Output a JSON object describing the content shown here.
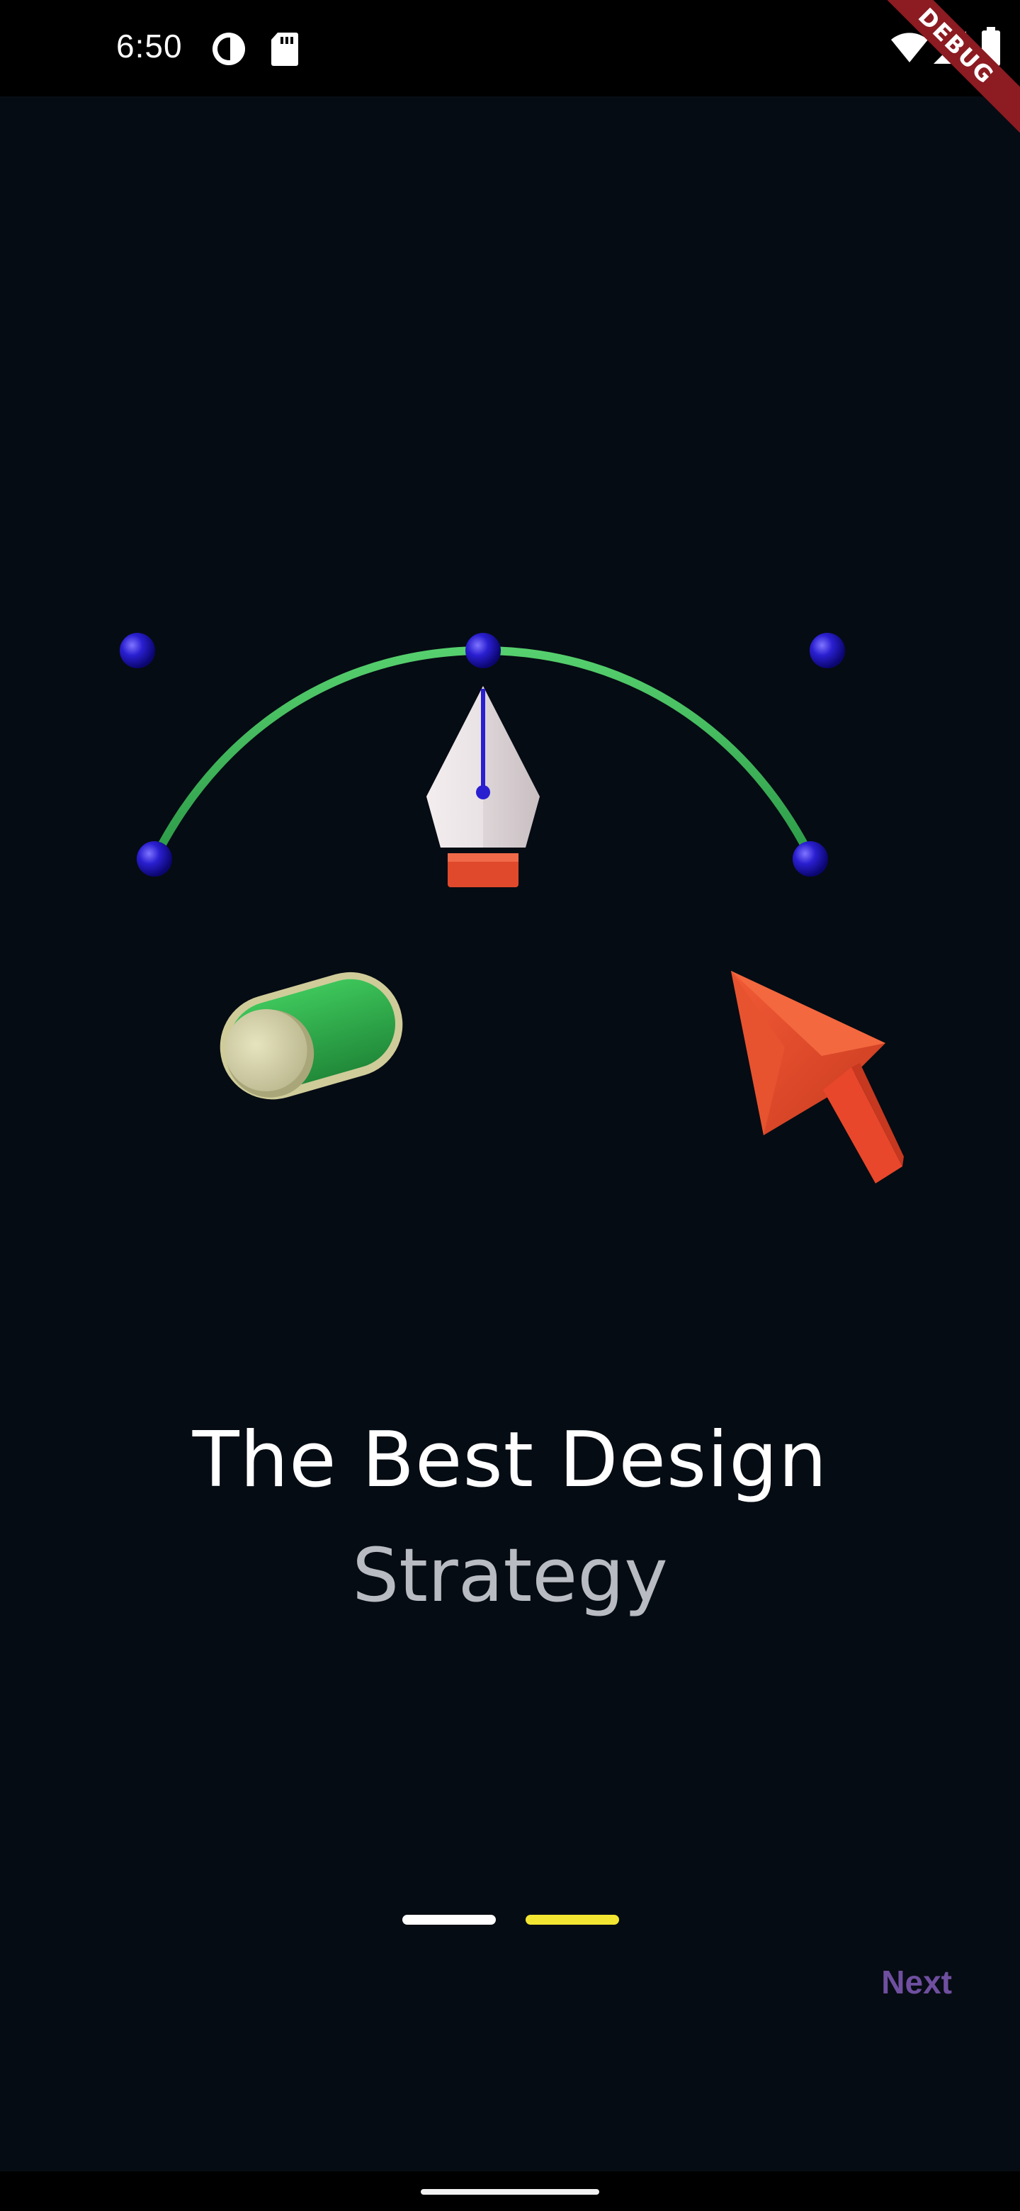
{
  "status_bar": {
    "time": "6:50",
    "icons": [
      "data-saver-icon",
      "sd-card-icon",
      "wifi-icon",
      "signal-icon",
      "battery-icon"
    ]
  },
  "debug_banner": "DEBUG",
  "illustration": {
    "items": [
      "bezier-curve-pen-tool",
      "toggle-switch",
      "cursor-arrow"
    ],
    "colors": {
      "curve": "#3cb55a",
      "anchor": "#2a1fd0",
      "pen_body": "#e6dfe1",
      "pen_base": "#e0492c",
      "toggle_track": "#2fae4a",
      "toggle_knob": "#d6d4a8",
      "cursor": "#e8472b"
    }
  },
  "onboarding": {
    "title": "The Best Design",
    "subtitle": "Strategy",
    "pages": 2,
    "active_page": 2,
    "indicator_colors": {
      "inactive": "#ffffff",
      "active": "#f2e632"
    },
    "next_label": "Next"
  },
  "colors": {
    "background": "#060c13",
    "accent": "#6f4fa0"
  }
}
